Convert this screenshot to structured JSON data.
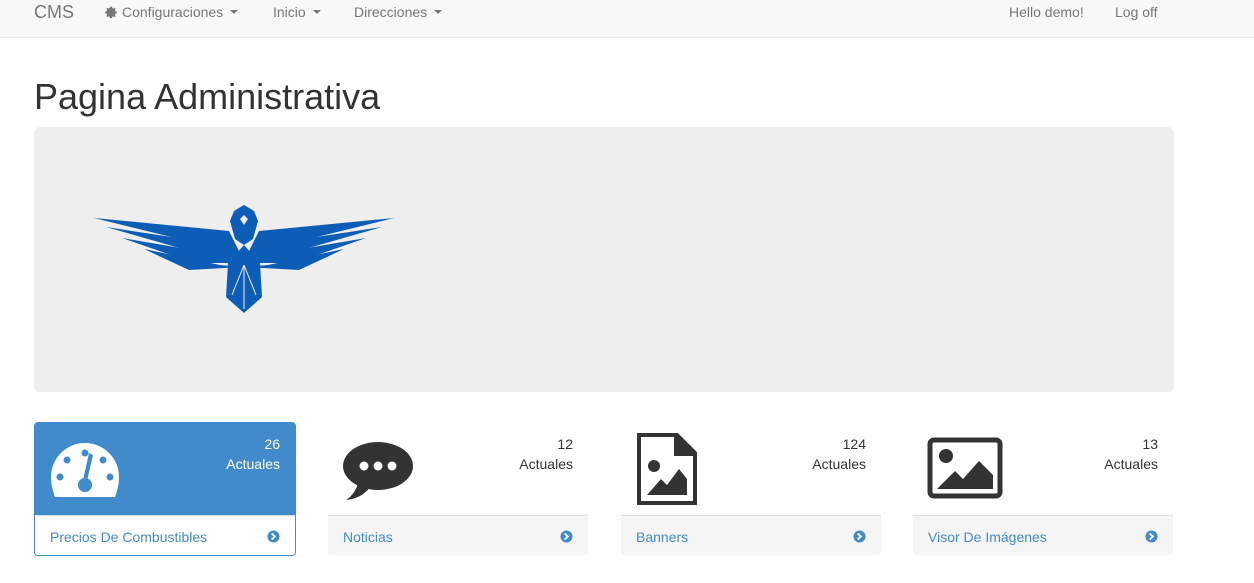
{
  "nav": {
    "brand": "CMS",
    "items": [
      {
        "label": "Configuraciones",
        "icon": "gear-icon",
        "dropdown": true
      },
      {
        "label": "Inicio",
        "dropdown": true
      },
      {
        "label": "Direcciones",
        "dropdown": true
      }
    ],
    "greeting": "Hello demo!",
    "logoff": "Log off"
  },
  "page": {
    "title": "Pagina Administrativa"
  },
  "panels": [
    {
      "count": "26",
      "sub": "Actuales",
      "link": "Precios De Combustibles",
      "icon": "dashboard-gauge-icon"
    },
    {
      "count": "12",
      "sub": "Actuales",
      "link": "Noticias",
      "icon": "comment-icon"
    },
    {
      "count": "124",
      "sub": "Actuales",
      "link": "Banners",
      "icon": "file-image-icon"
    },
    {
      "count": "13",
      "sub": "Actuales",
      "link": "Visor De Imágenes",
      "icon": "picture-icon"
    }
  ],
  "colors": {
    "primary": "#428bca",
    "eagle": "#0d5db6",
    "jumbotron": "#eeeeee"
  }
}
